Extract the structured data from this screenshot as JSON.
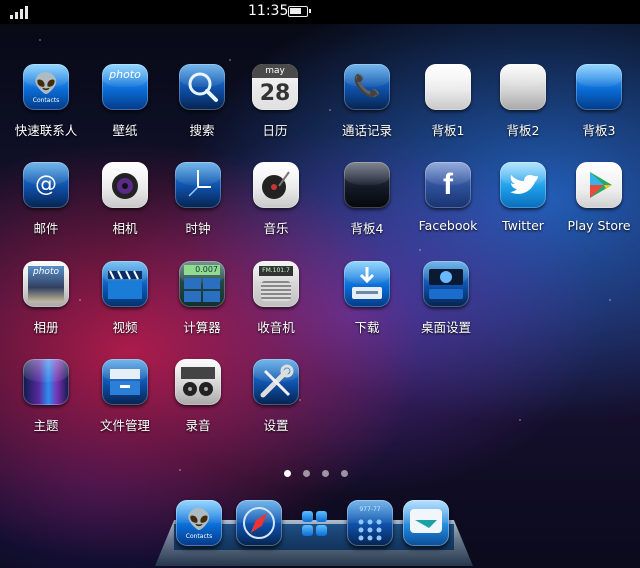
{
  "status_bar": {
    "time": "11:35",
    "battery_level": 0.75,
    "signal_bars": 4
  },
  "apps": [
    {
      "label": "快速联系人",
      "icon": "alien-contacts-icon",
      "sub": "Contacts"
    },
    {
      "label": "壁纸",
      "icon": "wallpaper-photo-icon",
      "sub": "photo"
    },
    {
      "label": "搜索",
      "icon": "magnifier-icon",
      "sub": ""
    },
    {
      "label": "日历",
      "icon": "calendar-icon",
      "sub": "may",
      "value": "28"
    },
    {
      "label": "通话记录",
      "icon": "phone-icon",
      "sub": ""
    },
    {
      "label": "背板1",
      "icon": "blank-white-tile-icon",
      "sub": ""
    },
    {
      "label": "背板2",
      "icon": "blank-silver-tile-icon",
      "sub": ""
    },
    {
      "label": "背板3",
      "icon": "blank-blue-tile-icon",
      "sub": ""
    },
    {
      "label": "邮件",
      "icon": "mail-at-icon",
      "sub": "@"
    },
    {
      "label": "相机",
      "icon": "camera-lens-icon",
      "sub": ""
    },
    {
      "label": "时钟",
      "icon": "clock-icon",
      "sub": ""
    },
    {
      "label": "音乐",
      "icon": "turntable-icon",
      "sub": ""
    },
    {
      "label": "背板4",
      "icon": "blank-black-tile-icon",
      "sub": ""
    },
    {
      "label": "Facebook",
      "icon": "facebook-f-icon",
      "sub": "f"
    },
    {
      "label": "Twitter",
      "icon": "twitter-bird-icon",
      "sub": ""
    },
    {
      "label": "Play Store",
      "icon": "play-store-triangle-icon",
      "sub": ""
    },
    {
      "label": "相册",
      "icon": "photo-album-icon",
      "sub": "photo"
    },
    {
      "label": "视频",
      "icon": "clapperboard-icon",
      "sub": ""
    },
    {
      "label": "计算器",
      "icon": "calculator-icon",
      "sub": "0.007"
    },
    {
      "label": "收音机",
      "icon": "radio-icon",
      "sub": "FM.101.7"
    },
    {
      "label": "下载",
      "icon": "download-tray-icon",
      "sub": ""
    },
    {
      "label": "桌面设置",
      "icon": "desktop-settings-icon",
      "sub": ""
    },
    {
      "label": "主题",
      "icon": "theme-aurora-icon",
      "sub": ""
    },
    {
      "label": "文件管理",
      "icon": "file-manager-icon",
      "sub": ""
    },
    {
      "label": "录音",
      "icon": "tape-recorder-icon",
      "sub": ""
    },
    {
      "label": "设置",
      "icon": "wrench-screwdriver-icon",
      "sub": ""
    }
  ],
  "page_indicator": {
    "pages": 4,
    "current": 1
  },
  "dock": [
    {
      "icon": "alien-contacts-icon",
      "sub": "Contacts"
    },
    {
      "icon": "compass-browser-icon",
      "sub": ""
    },
    {
      "icon": "app-drawer-icon",
      "sub": ""
    },
    {
      "icon": "dialer-keypad-icon",
      "sub": "977-77"
    },
    {
      "icon": "messages-icon",
      "sub": ""
    }
  ]
}
